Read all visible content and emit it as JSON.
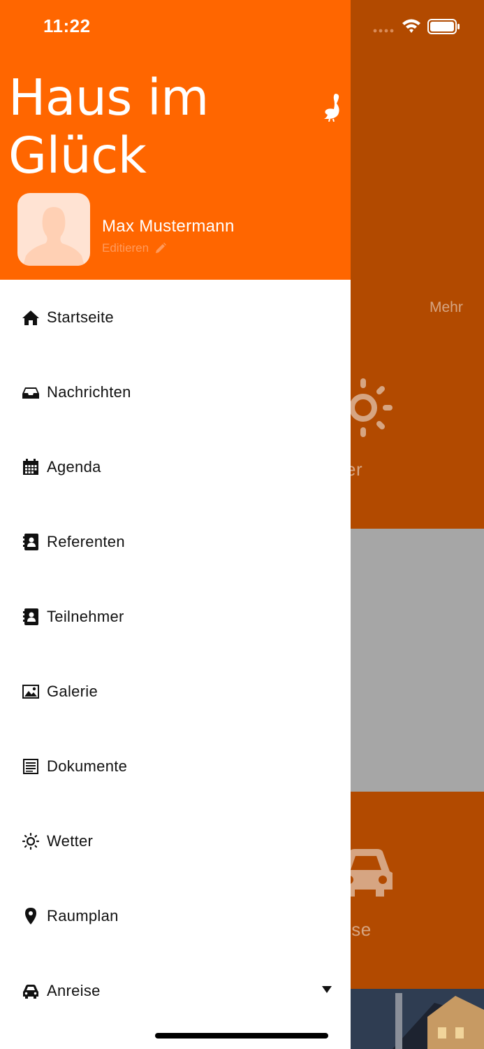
{
  "status_bar": {
    "time": "11:22"
  },
  "background": {
    "more_label": "Mehr",
    "tiles": [
      {
        "label": "Wetter",
        "icon": "sun-icon"
      },
      {
        "label": "Anreise",
        "icon": "car-icon"
      }
    ]
  },
  "drawer": {
    "brand": "Haus im Glück",
    "user": {
      "name": "Max Mustermann",
      "edit_label": "Editieren"
    },
    "menu": [
      {
        "label": "Startseite",
        "icon": "home-icon"
      },
      {
        "label": "Nachrichten",
        "icon": "inbox-icon"
      },
      {
        "label": "Agenda",
        "icon": "calendar-icon"
      },
      {
        "label": "Referenten",
        "icon": "contacts-book-icon"
      },
      {
        "label": "Teilnehmer",
        "icon": "contacts-book-icon"
      },
      {
        "label": "Galerie",
        "icon": "image-icon"
      },
      {
        "label": "Dokumente",
        "icon": "document-icon"
      },
      {
        "label": "Wetter",
        "icon": "sun-icon"
      },
      {
        "label": "Raumplan",
        "icon": "map-marker-icon"
      },
      {
        "label": "Anreise",
        "icon": "car-icon",
        "expandable": true
      }
    ]
  },
  "colors": {
    "brand_orange": "#ff6600",
    "dimmed_orange": "#b24a00",
    "dimmed_grey": "#a6a6a6",
    "avatar_bg": "#ffe3d3"
  }
}
